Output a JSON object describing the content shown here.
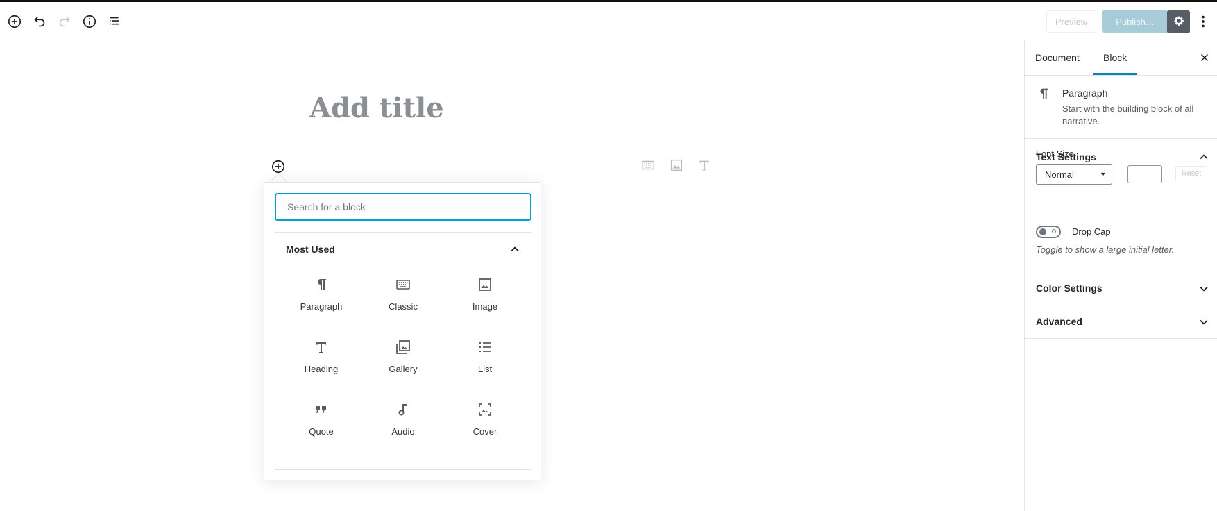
{
  "toolbar": {
    "icons": [
      "add-block-icon",
      "undo-icon",
      "redo-icon",
      "info-icon",
      "block-navigation-icon"
    ],
    "preview_label": "Preview",
    "publish_label": "Publish…",
    "settings_icon": "gear-icon",
    "more_icon": "more-vertical-icon"
  },
  "editor": {
    "title_placeholder": "Add title",
    "inline_tools": [
      "keyboard-icon",
      "image-icon",
      "heading-icon"
    ]
  },
  "inserter": {
    "search_placeholder": "Search for a block",
    "section_title": "Most Used",
    "blocks": [
      {
        "label": "Paragraph",
        "icon": "paragraph-icon"
      },
      {
        "label": "Classic",
        "icon": "keyboard-icon"
      },
      {
        "label": "Image",
        "icon": "image-icon"
      },
      {
        "label": "Heading",
        "icon": "heading-icon"
      },
      {
        "label": "Gallery",
        "icon": "gallery-icon"
      },
      {
        "label": "List",
        "icon": "list-icon"
      },
      {
        "label": "Quote",
        "icon": "quote-icon"
      },
      {
        "label": "Audio",
        "icon": "audio-icon"
      },
      {
        "label": "Cover",
        "icon": "cover-icon"
      }
    ]
  },
  "sidebar": {
    "tabs": [
      {
        "label": "Document",
        "active": false
      },
      {
        "label": "Block",
        "active": true
      }
    ],
    "block_card": {
      "title": "Paragraph",
      "description": "Start with the building block of all narrative."
    },
    "text_settings": {
      "title": "Text Settings",
      "expanded": true,
      "font_size_label": "Font Size",
      "font_size_value": "Normal",
      "custom_size_value": "",
      "reset_label": "Reset",
      "drop_cap_label": "Drop Cap",
      "drop_cap_enabled": false,
      "drop_cap_help": "Toggle to show a large initial letter."
    },
    "color_settings": {
      "title": "Color Settings",
      "expanded": false
    },
    "advanced": {
      "title": "Advanced",
      "expanded": false
    }
  },
  "colors": {
    "accent": "#0085ba",
    "search_focus": "#00a0d2",
    "publish_disabled": "#a7cbd8",
    "settings_active": "#555d66"
  }
}
